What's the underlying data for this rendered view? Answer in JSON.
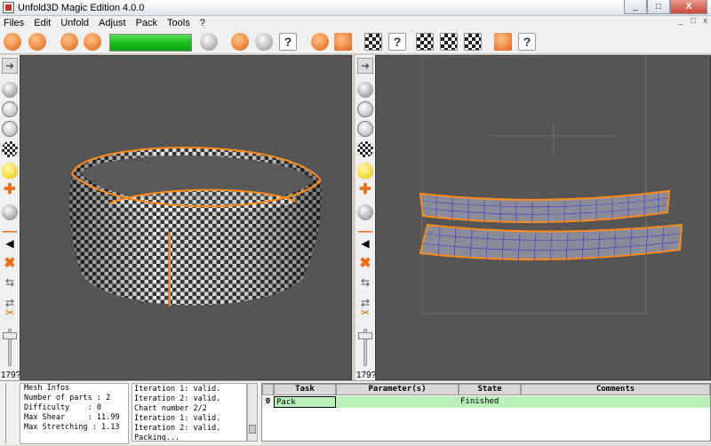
{
  "window": {
    "title": "Unfold3D Magic Edition 4.0.0",
    "min": "_",
    "max": "□",
    "close": "X"
  },
  "menu": {
    "items": [
      "Files",
      "Edit",
      "Unfold",
      "Adjust",
      "Pack",
      "Tools",
      "?"
    ],
    "right": [
      "_",
      "□",
      "x"
    ]
  },
  "toolbar": {
    "progress": 1.0,
    "accent": "#1bbf1b",
    "help_glyph": "?"
  },
  "sidebar_left": {
    "slider_value": "179?"
  },
  "sidebar_right": {
    "slider_value": "179?"
  },
  "mesh_infos": {
    "title": "Mesh Infos",
    "lines": [
      "Number of parts : 2",
      "Difficulty    : 0",
      "Max Shear     : 11.99",
      "Max Stretching : 1.13"
    ]
  },
  "log": {
    "lines": [
      "Iteration 1: valid.",
      "Iteration 2: valid.",
      "Chart number 2/2",
      "Iteration 1: valid.",
      "Iteration 2: valid.",
      "Packing..."
    ]
  },
  "task_table": {
    "headers": [
      "Task",
      "Parameter(s)",
      "State",
      "Comments"
    ],
    "rows": [
      {
        "index": "0",
        "task": "Pack",
        "params": "",
        "state": "Finished",
        "comments": ""
      }
    ]
  },
  "colors": {
    "viewport_bg": "#555555",
    "seam": "#ff8c1a",
    "row_ok": "#b8f0b8"
  }
}
